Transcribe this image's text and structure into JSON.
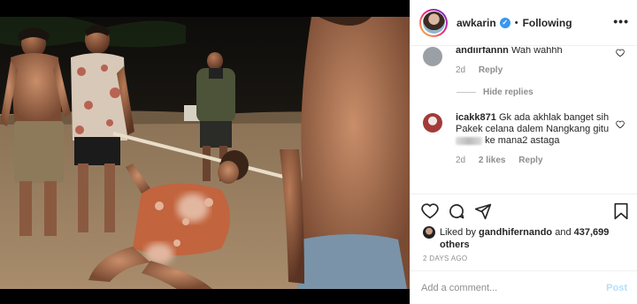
{
  "post": {
    "username": "awkarin",
    "verified_mark": "✓",
    "separator": "•",
    "follow_status": "Following",
    "more_icon": "more-horizontal-icon"
  },
  "comments": [
    {
      "username": "andiirfannn",
      "text": "Wah wahhh",
      "time": "2d",
      "reply_label": "Reply",
      "avatar_color": "#9aa0a6"
    },
    {
      "username": "icakk871",
      "text_before": "Gk ada akhlak banget sih Pakek celana dalem Nangkang gitu",
      "text_after": "ke mana2 astaga",
      "time": "2d",
      "likes": "2 likes",
      "reply_label": "Reply",
      "avatar_color": "#a33a3a"
    }
  ],
  "hide_replies_label": "Hide replies",
  "actions": {
    "like_icon": "heart-icon",
    "comment_icon": "comment-icon",
    "share_icon": "share-icon",
    "save_icon": "bookmark-icon"
  },
  "likes": {
    "prefix": "Liked by",
    "user": "gandhifernando",
    "conjunction": "and",
    "count": "437,699 others"
  },
  "timestamp": "2 DAYS AGO",
  "comment_box": {
    "placeholder": "Add a comment...",
    "post_label": "Post"
  },
  "colors": {
    "accent": "#3897f0",
    "post_disabled": "#b2dffc",
    "muted": "#8e8e8e"
  }
}
